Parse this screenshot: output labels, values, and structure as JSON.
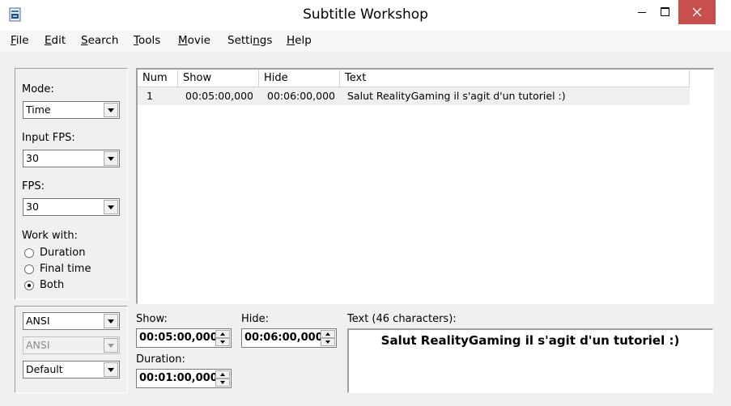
{
  "window": {
    "title": "Subtitle Workshop",
    "close_color": "#c7504f"
  },
  "icons": {
    "app": "subtitle-workshop-app-icon",
    "minimize": "minimize-icon",
    "maximize": "maximize-icon",
    "close": "close-icon"
  },
  "menu": {
    "items": [
      {
        "u": "F",
        "rest": "ile"
      },
      {
        "u": "E",
        "rest": "dit"
      },
      {
        "u": "S",
        "rest": "earch"
      },
      {
        "u": "T",
        "rest": "ools"
      },
      {
        "u": "M",
        "rest": "ovie"
      },
      {
        "pre": "Setti",
        "u": "n",
        "rest": "gs"
      },
      {
        "u": "H",
        "rest": "elp"
      }
    ]
  },
  "left": {
    "mode_label": "Mode:",
    "mode_value": "Time",
    "input_fps_label": "Input FPS:",
    "input_fps_value": "30",
    "fps_label": "FPS:",
    "fps_value": "30",
    "work_with_label": "Work with:",
    "radios": [
      {
        "label": "Duration",
        "checked": false
      },
      {
        "label": "Final time",
        "checked": false
      },
      {
        "label": "Both",
        "checked": true
      }
    ],
    "charset1": "ANSI",
    "charset2": "ANSI",
    "format": "Default"
  },
  "list": {
    "columns": [
      "Num",
      "Show",
      "Hide",
      "Text"
    ],
    "rows": [
      {
        "num": "1",
        "show": "00:05:00,000",
        "hide": "00:06:00,000",
        "text": "Salut RealityGaming il s'agit d'un tutoriel :)"
      }
    ]
  },
  "editor": {
    "show_label": "Show:",
    "show_value": "00:05:00,000",
    "hide_label": "Hide:",
    "hide_value": "00:06:00,000",
    "duration_label": "Duration:",
    "duration_value": "00:01:00,000",
    "text_label": "Text (46 characters):",
    "text_value": "Salut RealityGaming il s'agit d'un tutoriel :)"
  }
}
